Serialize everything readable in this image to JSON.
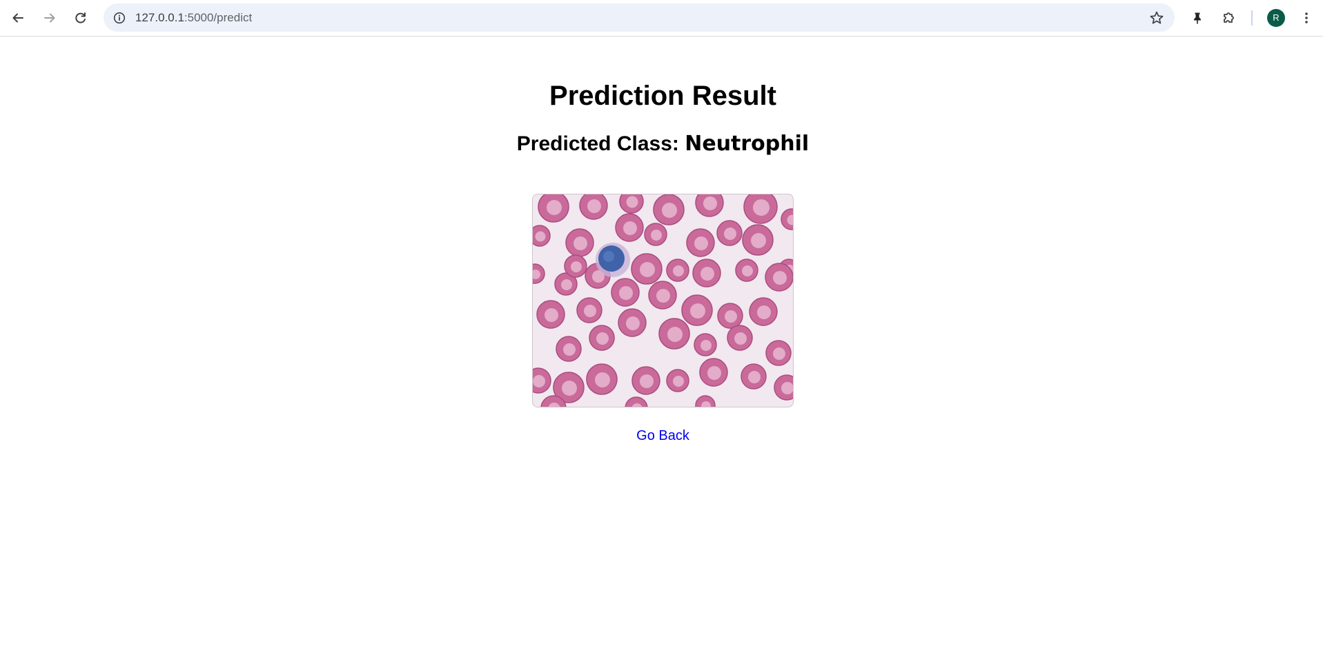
{
  "browser": {
    "url_host": "127.0.0.1",
    "url_rest": ":5000/predict",
    "avatar_letter": "R",
    "icons": {
      "back": "arrow-left-icon",
      "forward": "arrow-right-icon",
      "reload": "reload-icon",
      "site_info": "info-icon",
      "bookmark": "star-icon",
      "pin": "pin-icon",
      "extensions": "puzzle-icon",
      "menu": "kebab-menu-icon"
    }
  },
  "page": {
    "title": "Prediction Result",
    "predicted_label": "Predicted Class: ",
    "predicted_value": "Neutrophil",
    "back_link": "Go Back"
  },
  "colors": {
    "link": "#0000ee",
    "rbc": "#c96a9a",
    "wbc_nucleus": "#3f62a8",
    "avatar": "#0b5b49"
  }
}
